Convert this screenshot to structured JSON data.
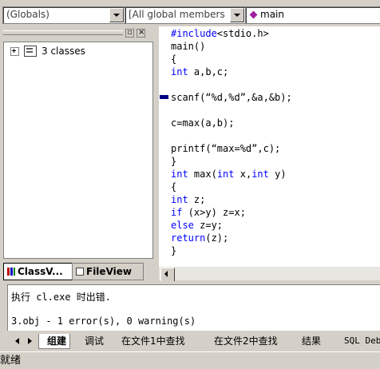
{
  "toolbar": {
    "scope_combo": "(Globals)",
    "members_combo": "[All global members",
    "function_combo": "main"
  },
  "workspace": {
    "tree_item": "3 classes",
    "tabs": [
      {
        "label": "ClassV...",
        "icon": "classview-icon",
        "active": true
      },
      {
        "label": "FileView",
        "icon": "fileview-icon",
        "active": false
      }
    ]
  },
  "editor": {
    "lines": [
      {
        "parts": [
          {
            "t": "#include",
            "k": true
          },
          {
            "t": "<stdio.h>",
            "k": false
          }
        ]
      },
      {
        "parts": [
          {
            "t": "main()",
            "k": false
          }
        ]
      },
      {
        "parts": [
          {
            "t": "{",
            "k": false
          }
        ]
      },
      {
        "parts": [
          {
            "t": "int",
            "k": true
          },
          {
            "t": " a,b,c;",
            "k": false
          }
        ]
      },
      {
        "parts": [
          {
            "t": "",
            "k": false
          }
        ]
      },
      {
        "parts": [
          {
            "t": "scanf(“%d,%d”,&a,&b);",
            "k": false
          }
        ]
      },
      {
        "parts": [
          {
            "t": "",
            "k": false
          }
        ]
      },
      {
        "parts": [
          {
            "t": "c=max(a,b);",
            "k": false
          }
        ]
      },
      {
        "parts": [
          {
            "t": "",
            "k": false
          }
        ]
      },
      {
        "parts": [
          {
            "t": "printf(“max=%d”,c);",
            "k": false
          }
        ]
      },
      {
        "parts": [
          {
            "t": "}",
            "k": false
          }
        ]
      },
      {
        "parts": [
          {
            "t": "int",
            "k": true
          },
          {
            "t": " max(",
            "k": false
          },
          {
            "t": "int",
            "k": true
          },
          {
            "t": " x,",
            "k": false
          },
          {
            "t": "int",
            "k": true
          },
          {
            "t": " y)",
            "k": false
          }
        ]
      },
      {
        "parts": [
          {
            "t": "{",
            "k": false
          }
        ]
      },
      {
        "parts": [
          {
            "t": "int",
            "k": true
          },
          {
            "t": " z;",
            "k": false
          }
        ]
      },
      {
        "parts": [
          {
            "t": "if",
            "k": true
          },
          {
            "t": " (x>y) z=x;",
            "k": false
          }
        ]
      },
      {
        "parts": [
          {
            "t": "else",
            "k": true
          },
          {
            "t": " z=y;",
            "k": false
          }
        ]
      },
      {
        "parts": [
          {
            "t": "return",
            "k": true
          },
          {
            "t": "(z);",
            "k": false
          }
        ]
      },
      {
        "parts": [
          {
            "t": "}",
            "k": false
          }
        ]
      }
    ]
  },
  "output": {
    "line1": "执行 cl.exe 时出错.",
    "line2": "3.obj - 1 error(s), 0 warning(s)",
    "tabs": [
      "组建",
      "调试",
      "在文件1中查找",
      "在文件2中查找",
      "结果",
      "SQL Deb"
    ]
  },
  "status_bar": {
    "text": "就绪"
  },
  "colors": {
    "keyword": "#0000ff",
    "chrome": "#d4d0c8"
  }
}
